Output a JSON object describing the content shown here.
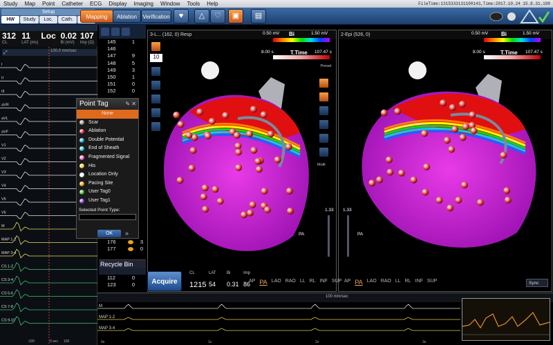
{
  "menu": [
    "Study",
    "Map",
    "Point",
    "Catheter",
    "ECG",
    "Display",
    "Imaging",
    "Window",
    "Tools",
    "Help"
  ],
  "file_time": "FileTime:1315333131100143,Time:2017.10.24 15.8.31.188",
  "setup": {
    "title": "Setup",
    "tabs": [
      "HW",
      "Study",
      "Loc.",
      "Cath.",
      "Map"
    ]
  },
  "toolbar": {
    "mapping": "Mapping",
    "ablation": "Ablation",
    "verification": "Verification"
  },
  "stats_top": [
    {
      "value": "312",
      "label": "CL"
    },
    {
      "value": "11",
      "label": "LAT (ms)"
    },
    {
      "value": "Loc",
      "label": ""
    },
    {
      "value": "0.02",
      "label": "Bi (mV)"
    },
    {
      "value": "107",
      "label": "Imp (Ω)"
    }
  ],
  "ecg": {
    "speed_top": "100.0 mm/sec",
    "leads": [
      "I",
      "II",
      "III",
      "aVR",
      "aVL",
      "aVF",
      "V1",
      "V2",
      "V3",
      "V4",
      "V5",
      "V6",
      "M",
      "MAP 1-2",
      "MAP 3-4",
      "CS 1-2",
      "CS 3-4",
      "CS 5-6",
      "CS 7-8",
      "CS 9-10"
    ],
    "axis": [
      "-100",
      "0 sec",
      "100"
    ]
  },
  "points": {
    "header_icons": [
      "list-icon",
      "lungs-icon",
      "filter-icon"
    ],
    "rows": [
      {
        "id": "145",
        "value": "1"
      },
      {
        "id": "146",
        "value": ""
      },
      {
        "id": "147",
        "value": "9"
      },
      {
        "id": "148",
        "value": "5"
      },
      {
        "id": "149",
        "value": "3"
      },
      {
        "id": "150",
        "value": "1"
      },
      {
        "id": "151",
        "value": "0"
      },
      {
        "id": "152",
        "value": "0"
      }
    ],
    "bottom_rows": [
      {
        "id": "176",
        "value": "3",
        "color": "#e8a020"
      },
      {
        "id": "177",
        "value": "0",
        "color": "#e8a020"
      }
    ]
  },
  "recycle": {
    "title": "Recycle Bin",
    "rows": [
      {
        "id": "112",
        "value": "0"
      },
      {
        "id": "123",
        "value": "0"
      }
    ]
  },
  "point_tag": {
    "title": "Point Tag",
    "items": [
      {
        "label": "None",
        "color": ""
      },
      {
        "label": "Scar",
        "color": "#9a9a9a"
      },
      {
        "label": "Ablation",
        "color": "#d8324a"
      },
      {
        "label": "Double Potential",
        "color": "#28a8d8"
      },
      {
        "label": "End of Sheath",
        "color": "#28c8d0"
      },
      {
        "label": "Fragmented Signal",
        "color": "#f070c8"
      },
      {
        "label": "His",
        "color": "#f0d040"
      },
      {
        "label": "Location Only",
        "color": "#ffffff"
      },
      {
        "label": "Pacing Site",
        "color": "#f0a020"
      },
      {
        "label": "User Tag0",
        "color": "#40c040"
      },
      {
        "label": "User Tag1",
        "color": "#8a40d8"
      }
    ],
    "selected_label": "Selected Point Type:",
    "ok": "OK",
    "more": "»"
  },
  "map_left": {
    "title": "3-L... (162, 0) Resp",
    "bi_min": "0.50 mV",
    "bi_name": "Bi",
    "bi_max": "1.50 mV",
    "tt_min": "8.00 s",
    "tt_name": "T.Time",
    "tt_max": "107.47 s",
    "zoom": "10",
    "preset": "Preset",
    "multi": "Multi",
    "slider_val": "1.33",
    "orient": "PA"
  },
  "map_right": {
    "title": "2-Epi (526, 0)",
    "bi_min": "0.50 mV",
    "bi_name": "Bi",
    "bi_max": "1.50 mV",
    "tt_min": "8.00 s",
    "tt_name": "T.Time",
    "tt_max": "107.47 s",
    "slider_val": "1.33",
    "orient": "PA"
  },
  "acquire": {
    "label": "Acquire"
  },
  "stats_bottom": {
    "headers": [
      "CL",
      "LAT",
      "Bi",
      "Imp"
    ],
    "values": [
      "1215",
      "54",
      "0.31",
      "86"
    ]
  },
  "view_buttons": [
    "AP",
    "PA",
    "LAO",
    "RAO",
    "LL",
    "RL",
    "INF",
    "SUP"
  ],
  "sync": "Sync",
  "bottom_ecg": {
    "speed": "100 mm/sec",
    "leads": [
      "M",
      "MAP 1-2",
      "MAP 3-4"
    ],
    "axis": [
      "0s",
      "1s",
      "2s",
      "3s"
    ]
  },
  "colors": {
    "accent": "#e06a1c",
    "toolbar": "#2a5288",
    "map_pink": "#e020e0"
  }
}
